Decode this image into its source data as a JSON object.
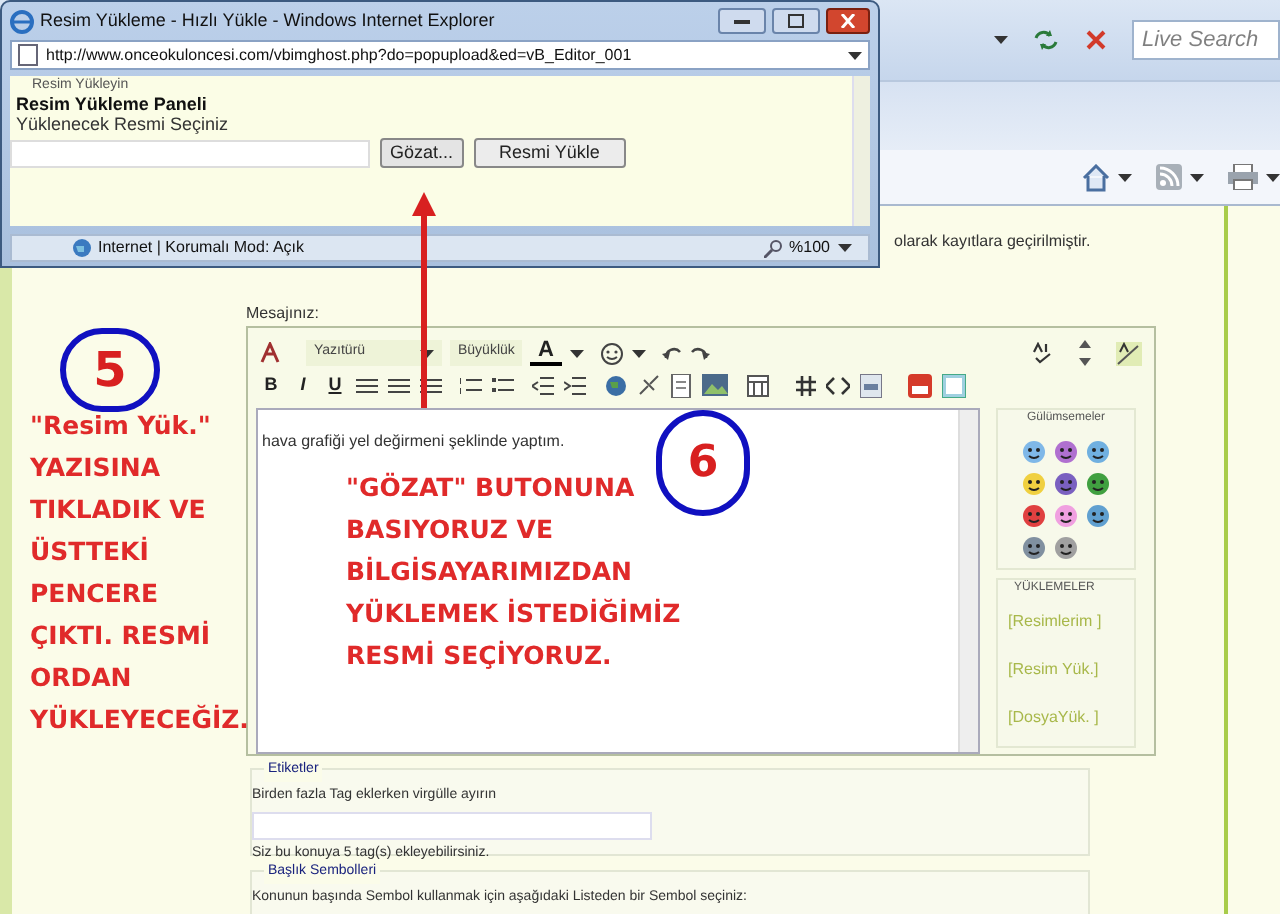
{
  "browser": {
    "search_placeholder": "Live Search"
  },
  "page": {
    "notice": "olarak kayıtlara geçirilmiştir.",
    "message_label": "Mesajınız:",
    "editor": {
      "font_select": "Yazıtürü",
      "size_select": "Büyüklük",
      "color_glyph": "A",
      "format_buttons": [
        "B",
        "I",
        "U"
      ],
      "text": "hava grafiği yel değirmeni şeklinde yaptım."
    },
    "smilies": {
      "title": "Gülümsemeler"
    },
    "uploads": {
      "title": "YÜKLEMELER",
      "links": [
        "[Resimlerim ]",
        "[Resim Yük.]",
        "[DosyaYük. ]"
      ]
    },
    "tags": {
      "legend": "Etiketler",
      "hint": "Birden fazla Tag eklerken virgülle ayırın",
      "note": "Siz bu konuya 5 tag(s) ekleyebilirsiniz."
    },
    "symbols": {
      "legend": "Başlık Sembolleri",
      "hint": "Konunun başında Sembol kullanmak için aşağıdaki Listeden bir Sembol seçiniz:"
    }
  },
  "popup": {
    "title": "Resim Yükleme - Hızlı Yükle - Windows Internet Explorer",
    "url": "http://www.onceokuloncesi.com/vbimghost.php?do=popupload&ed=vB_Editor_001",
    "section": "Resim Yükleyin",
    "heading": "Resim Yükleme Paneli",
    "prompt": "Yüklenecek Resmi Seçiniz",
    "browse_button": "Gözat...",
    "upload_button": "Resmi Yükle",
    "status": "Internet | Korumalı Mod: Açık",
    "zoom": "%100"
  },
  "annotations": [
    {
      "number": "5",
      "lines": [
        "\"Resim Yük.\"",
        "YAZISINA",
        "TIKLADIK VE",
        "ÜSTTEKİ",
        "PENCERE",
        "ÇIKTI. RESMİ",
        "ORDAN",
        "YÜKLEYECEĞİZ."
      ]
    },
    {
      "number": "6",
      "lines": [
        "\"GÖZAT\" BUTONUNA",
        "BASIYORUZ VE",
        "BİLGİSAYARIMIZDAN",
        "YÜKLEMEK İSTEDİĞİMİZ",
        "RESMİ SEÇİYORUZ."
      ]
    }
  ]
}
